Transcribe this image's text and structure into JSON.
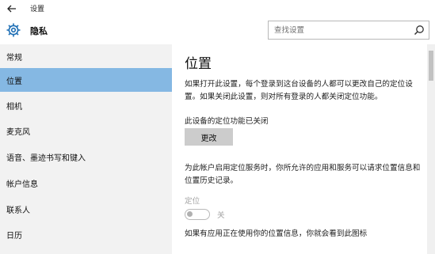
{
  "window": {
    "title": "设置"
  },
  "header": {
    "title": "隐私"
  },
  "search": {
    "placeholder": "查找设置"
  },
  "sidebar": {
    "items": [
      {
        "label": "常规",
        "active": false
      },
      {
        "label": "位置",
        "active": true
      },
      {
        "label": "相机",
        "active": false
      },
      {
        "label": "麦克风",
        "active": false
      },
      {
        "label": "语音、墨迹书写和键入",
        "active": false
      },
      {
        "label": "帐户信息",
        "active": false
      },
      {
        "label": "联系人",
        "active": false
      },
      {
        "label": "日历",
        "active": false
      }
    ]
  },
  "main": {
    "title": "位置",
    "description": "如果打开此设置，每个登录到这台设备的人都可以更改自己的定位设置。如果关闭此设置，则对所有登录的人都关闭定位功能。",
    "status_text": "此设备的定位功能已关闭",
    "change_button": "更改",
    "account_description": "为此帐户启用定位服务时，你所允许的应用和服务可以请求位置信息和位置历史记录。",
    "location_label": "定位",
    "toggle_state": "关",
    "toggle_on": false,
    "bottom_text": "如果有应用正在使用你的位置信息，你就会看到此图标"
  },
  "colors": {
    "accent": "#85b8e3",
    "sidebar_bg": "#f2f2f2",
    "button_bg": "#cccccc",
    "icon_blue": "#1f6fb5",
    "disabled_text": "#a5a5a5"
  },
  "icons": {
    "back": "back-arrow-icon",
    "settings": "gear-icon",
    "search": "search-icon"
  }
}
